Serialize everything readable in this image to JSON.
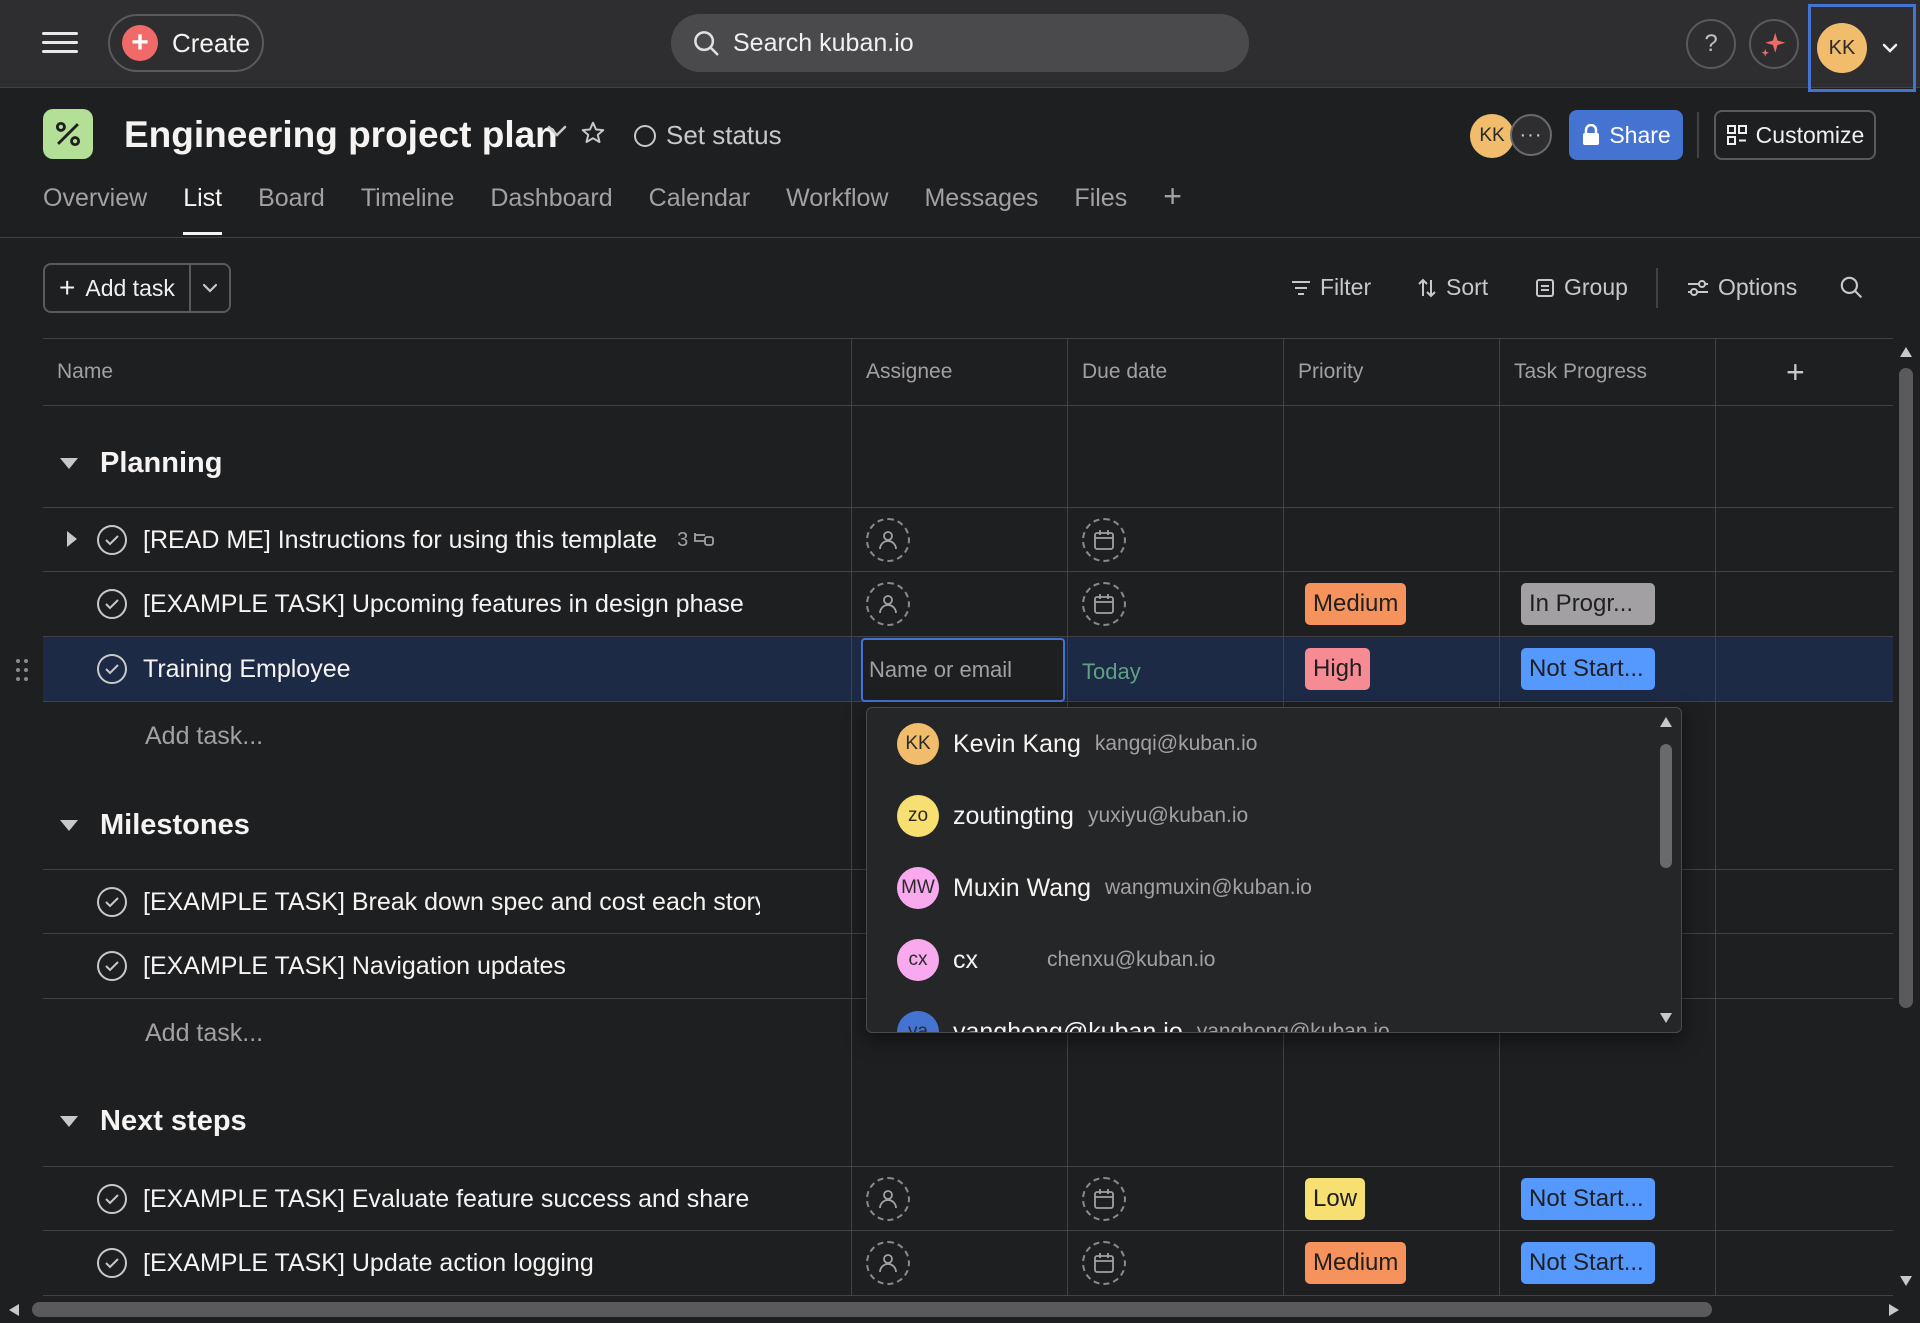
{
  "topbar": {
    "create_label": "Create",
    "search_placeholder": "Search kuban.io",
    "help_label": "?",
    "account_initials": "KK"
  },
  "project": {
    "title": "Engineering project plan",
    "set_status_label": "Set status",
    "member_initials": "KK",
    "share_label": "Share",
    "customize_label": "Customize"
  },
  "tabs": [
    {
      "label": "Overview"
    },
    {
      "label": "List"
    },
    {
      "label": "Board"
    },
    {
      "label": "Timeline"
    },
    {
      "label": "Dashboard"
    },
    {
      "label": "Calendar"
    },
    {
      "label": "Workflow"
    },
    {
      "label": "Messages"
    },
    {
      "label": "Files"
    }
  ],
  "active_tab": "List",
  "toolbar": {
    "add_task_label": "Add task",
    "filter_label": "Filter",
    "sort_label": "Sort",
    "group_label": "Group",
    "options_label": "Options"
  },
  "columns": [
    "Name",
    "Assignee",
    "Due date",
    "Priority",
    "Task Progress"
  ],
  "sections": [
    {
      "title": "Planning",
      "tasks": [
        {
          "name": "[READ ME] Instructions for using this template",
          "subtasks": "3",
          "priority": "",
          "progress": ""
        },
        {
          "name": "[EXAMPLE TASK] Upcoming features in design phase",
          "priority": "Medium",
          "progress": "In Progr..."
        },
        {
          "name": "Training Employee",
          "due": "Today",
          "priority": "High",
          "progress": "Not Start..."
        }
      ],
      "add_task_label": "Add task..."
    },
    {
      "title": "Milestones",
      "tasks": [
        {
          "name": "[EXAMPLE TASK] Break down spec and cost each story"
        },
        {
          "name": "[EXAMPLE TASK] Navigation updates"
        }
      ],
      "add_task_label": "Add task..."
    },
    {
      "title": "Next steps",
      "tasks": [
        {
          "name": "[EXAMPLE TASK] Evaluate feature success and share",
          "priority": "Low",
          "progress": "Not Start..."
        },
        {
          "name": "[EXAMPLE TASK] Update action logging",
          "priority": "Medium",
          "progress": "Not Start..."
        }
      ]
    }
  ],
  "assignee_input": {
    "placeholder": "Name or email"
  },
  "assignee_options": [
    {
      "initials": "KK",
      "name": "Kevin Kang",
      "email": "kangqi@kuban.io"
    },
    {
      "initials": "zo",
      "name": "zoutingting",
      "email": "yuxiyu@kuban.io"
    },
    {
      "initials": "MW",
      "name": "Muxin Wang",
      "email": "wangmuxin@kuban.io"
    },
    {
      "initials": "cx",
      "name": "cx",
      "email": "chenxu@kuban.io"
    },
    {
      "initials": "ya",
      "name": "yanghong@kuban.io",
      "email": "yanghong@kuban.io"
    }
  ],
  "colors": {
    "background": "#1e1f21",
    "topbar": "#2e2e30",
    "accent": "#4573d2",
    "create": "#f06a6a",
    "medium": "#f6925c",
    "high": "#f78b94",
    "low": "#f8df72",
    "in_progress": "#a2a0a2",
    "not_started": "#5599ff",
    "selected_row": "#1d2a45"
  }
}
